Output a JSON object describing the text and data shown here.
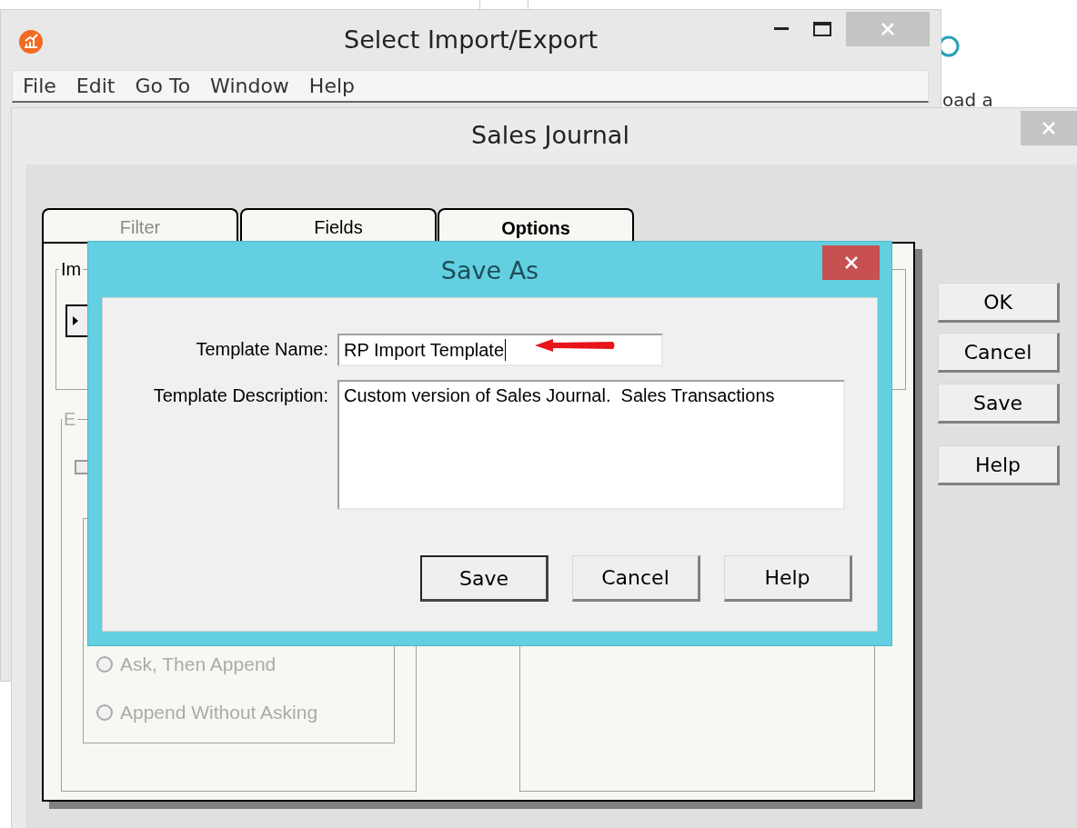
{
  "background_page": {
    "text": "oad a"
  },
  "main_window": {
    "title": "Select Import/Export",
    "menu": [
      "File",
      "Edit",
      "Go To",
      "Window",
      "Help"
    ]
  },
  "sales_journal": {
    "title": "Sales Journal",
    "tabs": [
      {
        "label": "Filter",
        "selected": false,
        "disabled": true
      },
      {
        "label": "Fields",
        "selected": false,
        "disabled": false
      },
      {
        "label": "Options",
        "selected": true,
        "disabled": false
      }
    ],
    "group_1": {
      "label": "Im"
    },
    "group_2": {
      "label": "E",
      "checkbox": {
        "checked": false
      },
      "radios": [
        {
          "label": "Ask, Then Append",
          "selected": false,
          "disabled": true
        },
        {
          "label": "Append Without Asking",
          "selected": false,
          "disabled": true
        }
      ]
    },
    "buttons": [
      "OK",
      "Cancel",
      "Save",
      "Help"
    ]
  },
  "save_as": {
    "title": "Save As",
    "fields": [
      {
        "label": "Template Name:",
        "value": "RP Import Template",
        "kind": "line"
      },
      {
        "label": "Template Description:",
        "value": "Custom version of Sales Journal.  Sales Transactions",
        "kind": "area"
      }
    ],
    "buttons": [
      "Save",
      "Cancel",
      "Help"
    ]
  }
}
